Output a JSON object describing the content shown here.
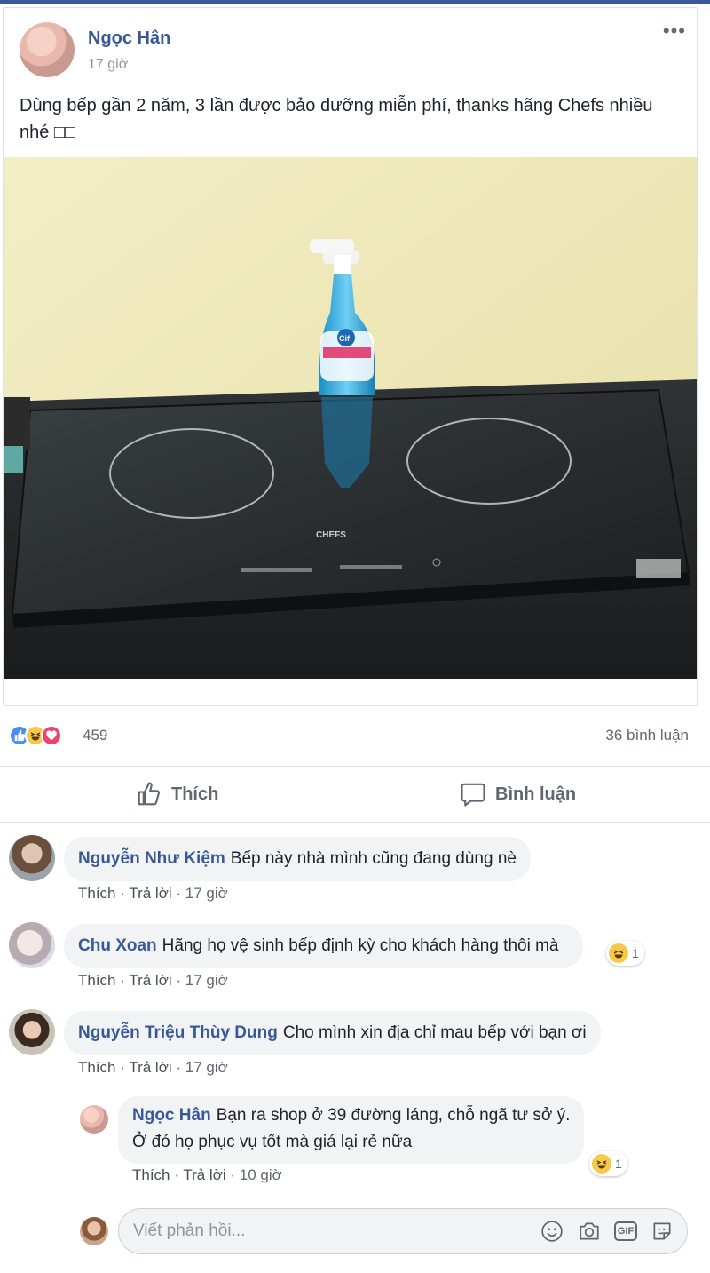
{
  "post": {
    "author": "Ngọc Hân",
    "time": "17 giờ",
    "text": "Dùng bếp gần 2 năm, 3 lần được bảo dưỡng miễn phí, thanks hãng Chefs nhiều nhé □□",
    "more_label": "•••"
  },
  "stats": {
    "reaction_count": "459",
    "comment_count": "36 bình luận"
  },
  "actions": {
    "like_label": "Thích",
    "comment_label": "Bình luận"
  },
  "comments": [
    {
      "author": "Nguyễn Như Kiệm",
      "text": "Bếp này nhà mình cũng đang dùng nè",
      "like": "Thích",
      "reply": "Trả lời",
      "time": "17 giờ"
    },
    {
      "author": "Chu Xoan",
      "text": "Hãng họ vệ sinh bếp định kỳ cho khách hàng thôi mà",
      "like": "Thích",
      "reply": "Trả lời",
      "time": "17 giờ",
      "reaction_count": "1"
    },
    {
      "author": "Nguyễn Triệu Thùy Dung",
      "text": "Cho mình xin địa chỉ mau bếp với bạn ơi",
      "like": "Thích",
      "reply": "Trả lời",
      "time": "17 giờ"
    }
  ],
  "reply": {
    "author": "Ngọc Hân",
    "text_line1": "Bạn ra shop ở 39 đường láng, chỗ ngã tư sở ý.",
    "text_line2": "Ở đó họ phục vụ tốt mà giá lại rẻ nữa",
    "like": "Thích",
    "reply": "Trả lời",
    "time": "10 giờ",
    "reaction_count": "1"
  },
  "reply_box": {
    "placeholder": "Viết phản hồi..."
  },
  "photo_texts": {
    "bottle_brand": "Cif",
    "cooktop_brand": "CHEFS"
  },
  "colors": {
    "link": "#385898",
    "accent": "#3b5998",
    "like_blue": "#4a8ef5",
    "love_red": "#f0436b",
    "haha_yellow": "#f7c94a"
  }
}
